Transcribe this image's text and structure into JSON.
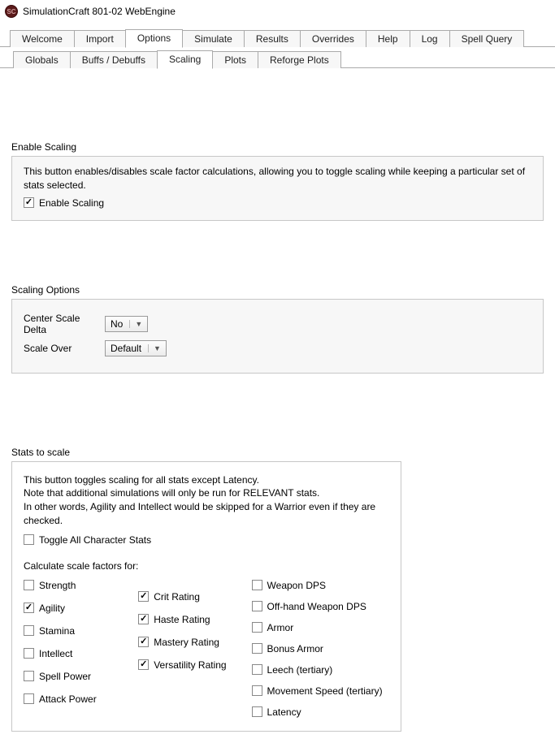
{
  "window": {
    "title": "SimulationCraft 801-02 WebEngine"
  },
  "main_tabs": {
    "items": [
      "Welcome",
      "Import",
      "Options",
      "Simulate",
      "Results",
      "Overrides",
      "Help",
      "Log",
      "Spell Query"
    ],
    "active": 2
  },
  "sub_tabs": {
    "items": [
      "Globals",
      "Buffs / Debuffs",
      "Scaling",
      "Plots",
      "Reforge Plots"
    ],
    "active": 2
  },
  "enable_scaling": {
    "title": "Enable Scaling",
    "desc": "This button enables/disables scale factor calculations, allowing you to toggle scaling while keeping a particular set of stats selected.",
    "checkbox_label": "Enable Scaling",
    "checked": true
  },
  "scaling_options": {
    "title": "Scaling Options",
    "center_label": "Center Scale Delta",
    "center_value": "No",
    "scale_over_label": "Scale Over",
    "scale_over_value": "Default"
  },
  "stats": {
    "title": "Stats to scale",
    "desc1": "This button toggles scaling for all stats except Latency.",
    "desc2": "Note that additional simulations will only be run for RELEVANT stats.",
    "desc3": "In other words, Agility and Intellect would be skipped for a Warrior even if they are checked.",
    "toggle_all_label": "Toggle All Character Stats",
    "toggle_all_checked": false,
    "calc_label": "Calculate scale factors for:",
    "col1": [
      {
        "label": "Strength",
        "checked": false
      },
      {
        "label": "Agility",
        "checked": true
      },
      {
        "label": "Stamina",
        "checked": false
      },
      {
        "label": "Intellect",
        "checked": false
      },
      {
        "label": "Spell Power",
        "checked": false
      },
      {
        "label": "Attack Power",
        "checked": false
      }
    ],
    "col2": [
      {
        "label": "Crit Rating",
        "checked": true
      },
      {
        "label": "Haste Rating",
        "checked": true
      },
      {
        "label": "Mastery Rating",
        "checked": true
      },
      {
        "label": "Versatility Rating",
        "checked": true
      }
    ],
    "col3": [
      {
        "label": "Weapon DPS",
        "checked": false
      },
      {
        "label": "Off-hand Weapon DPS",
        "checked": false
      },
      {
        "label": "Armor",
        "checked": false
      },
      {
        "label": "Bonus Armor",
        "checked": false
      },
      {
        "label": "Leech (tertiary)",
        "checked": false
      },
      {
        "label": "Movement Speed (tertiary)",
        "checked": false
      },
      {
        "label": "Latency",
        "checked": false
      }
    ]
  }
}
